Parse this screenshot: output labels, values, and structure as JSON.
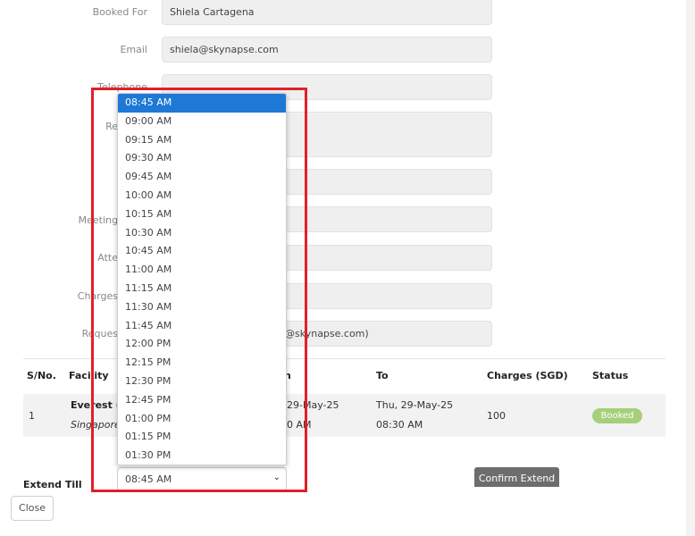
{
  "form": {
    "booked_for_label": "Booked For",
    "booked_for_value": "Shiela Cartagena",
    "email_label": "Email",
    "email_value": "shiela@skynapse.com",
    "telephone_label": "Telephone",
    "remarks_label": "Re",
    "meeting_label": "Meeting",
    "attendees_label": "Atte",
    "charges_label": "Charges",
    "requester_label": "Reques",
    "requester_value_fragment": "@skynapse.com)"
  },
  "table": {
    "headers": [
      "S/No.",
      "Facility",
      "n",
      "To",
      "Charges (SGD)",
      "Status"
    ],
    "row": {
      "sno": "1",
      "facility_name": "Everest (10",
      "facility_location": "Singapore",
      "from_date": "29-May-25",
      "from_time": "0 AM",
      "to_date": "Thu, 29-May-25",
      "to_time": "08:30 AM",
      "charges": "100",
      "status": "Booked"
    }
  },
  "extend": {
    "label": "Extend Till",
    "selected": "08:45 AM",
    "options": [
      "08:45 AM",
      "09:00 AM",
      "09:15 AM",
      "09:30 AM",
      "09:45 AM",
      "10:00 AM",
      "10:15 AM",
      "10:30 AM",
      "10:45 AM",
      "11:00 AM",
      "11:15 AM",
      "11:30 AM",
      "11:45 AM",
      "12:00 PM",
      "12:15 PM",
      "12:30 PM",
      "12:45 PM",
      "01:00 PM",
      "01:15 PM",
      "01:30 PM"
    ]
  },
  "buttons": {
    "confirm_extend": "Confirm Extend",
    "close": "Close"
  },
  "colors": {
    "highlight": "#1e78d6",
    "status_booked": "#a5cf7a",
    "annotation_box": "#e0202a"
  }
}
